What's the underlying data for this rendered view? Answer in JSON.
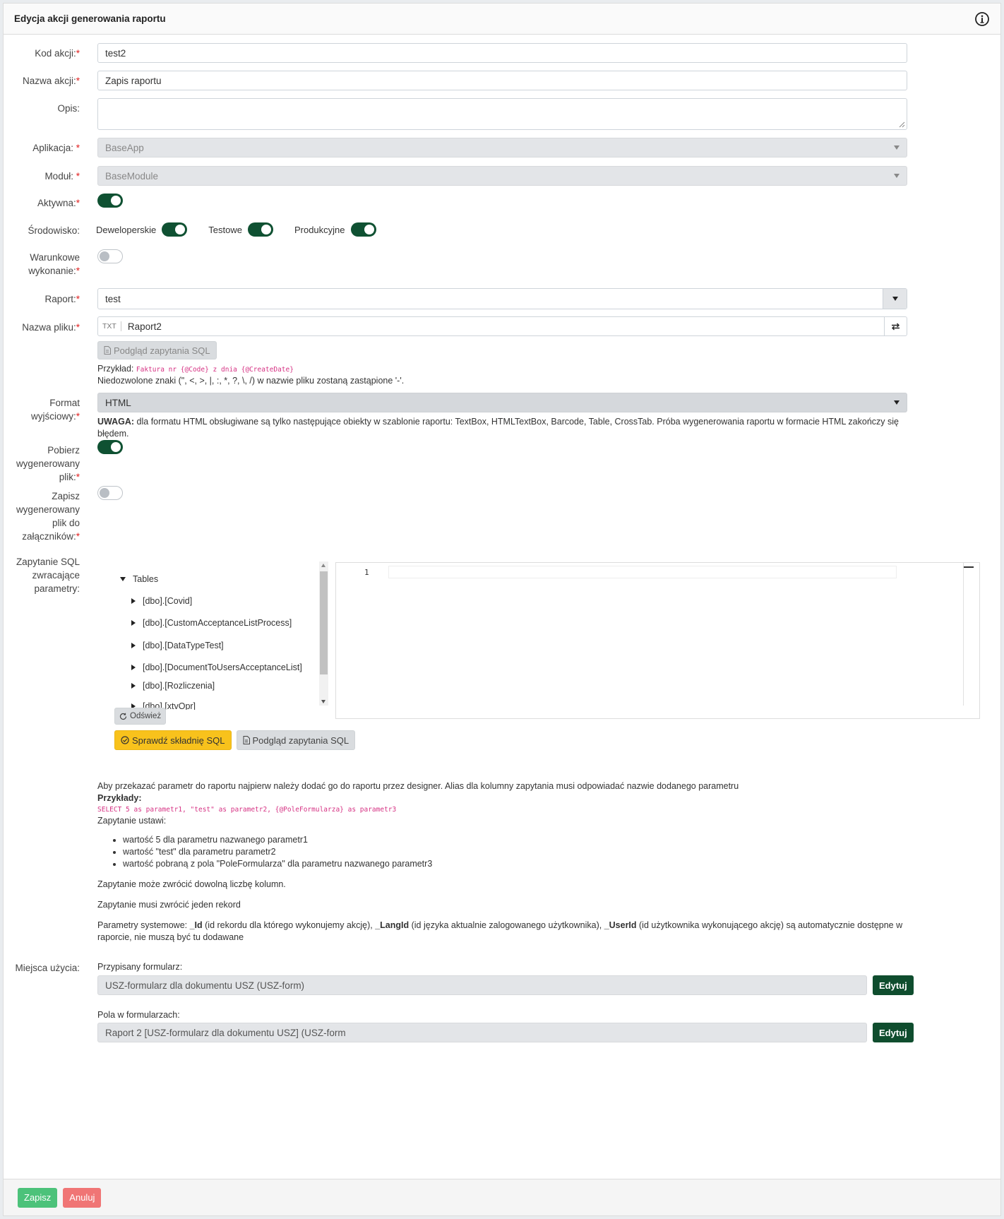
{
  "header": {
    "title": "Edycja akcji generowania raportu"
  },
  "fields": {
    "kod_akcji": {
      "label": "Kod akcji:",
      "value": "test2"
    },
    "nazwa_akcji": {
      "label": "Nazwa akcji:",
      "value": "Zapis raportu"
    },
    "opis": {
      "label": "Opis:",
      "value": ""
    },
    "aplikacja": {
      "label": "Aplikacja:",
      "value": "BaseApp"
    },
    "modul": {
      "label": "Moduł:",
      "value": "BaseModule"
    },
    "aktywna": {
      "label": "Aktywna:",
      "on": true
    },
    "srodowisko": {
      "label": "Środowisko:",
      "options": [
        {
          "label": "Deweloperskie",
          "on": true
        },
        {
          "label": "Testowe",
          "on": true
        },
        {
          "label": "Produkcyjne",
          "on": true
        }
      ]
    },
    "warunkowe": {
      "label_line1": "Warunkowe",
      "label_line2": "wykonanie:",
      "on": false
    },
    "raport": {
      "label": "Raport:",
      "value": "test"
    },
    "nazwa_pliku": {
      "label": "Nazwa pliku:",
      "prefix": "TXT",
      "value": "Raport2",
      "preview_button": "Podgląd zapytania SQL",
      "example_label": "Przykład:",
      "example_code": "Faktura nr {@Code} z dnia {@CreateDate}",
      "note": "Niedozwolone znaki (\", <, >, |, :, *, ?, \\, /) w nazwie pliku zostaną zastąpione '-'."
    },
    "format": {
      "label_line1": "Format",
      "label_line2": "wyjściowy:",
      "value": "HTML",
      "warning_bold": "UWAGA:",
      "warning_text": " dla formatu HTML obsługiwane są tylko następujące obiekty w szablonie raportu: TextBox, HTMLTextBox, Barcode, Table, CrossTab. Próba wygenerowania raportu w formacie HTML zakończy się błędem."
    },
    "pobierz": {
      "label_line1": "Pobierz",
      "label_line2": "wygenerowany",
      "label_line3": "plik:",
      "on": true
    },
    "zapisz": {
      "label_line1": "Zapisz",
      "label_line2": "wygenerowany",
      "label_line3": "plik do",
      "label_line4": "załączników:",
      "on": false
    },
    "sql": {
      "label_line1": "Zapytanie SQL",
      "label_line2": "zwracające",
      "label_line3": "parametry:",
      "tree_root": "Tables",
      "tree_items": [
        "[dbo].[Covid]",
        "[dbo].[CustomAcceptanceListProcess]",
        "[dbo].[DataTypeTest]",
        "[dbo].[DocumentToUsersAcceptanceList]",
        "[dbo].[Rozliczenia]",
        "[dbo].[xtvOpr]"
      ],
      "refresh_button": "Odśwież",
      "line_number": "1",
      "check_button": "Sprawdź składnię SQL",
      "preview_button": "Podgląd zapytania SQL"
    }
  },
  "help": {
    "intro": "Aby przekazać parametr do raportu najpierw należy dodać go do raportu przez designer. Alias dla kolumny zapytania musi odpowiadać nazwie dodanego parametru",
    "examples_label": "Przykłady:",
    "code": "SELECT 5 as parametr1, \"test\" as parametr2, {@PoleFormularza} as parametr3",
    "sets": "Zapytanie ustawi:",
    "bullets": [
      "wartość 5 dla parametru nazwanego parametr1",
      "wartość \"test\" dla parametru parametr2",
      "wartość pobraną z pola \"PoleFormularza\" dla parametru nazwanego parametr3"
    ],
    "p1": "Zapytanie może zwrócić dowolną liczbę kolumn.",
    "p2": "Zapytanie musi zwrócić jeden rekord",
    "sys_prefix": "Parametry systemowe: ",
    "sys_id": "_Id",
    "sys_id_desc": " (id rekordu dla którego wykonujemy akcję), ",
    "sys_lang": "_LangId",
    "sys_lang_desc": " (id języka aktualnie zalogowanego użytkownika), ",
    "sys_user": "_UserId",
    "sys_user_desc": " (id użytkownika wykonującego akcję) są automatycznie dostępne w raporcie, nie muszą być tu dodawane"
  },
  "usage": {
    "label": "Miejsca użycia:",
    "form_label": "Przypisany formularz:",
    "form_value": "USZ-formularz dla dokumentu USZ (USZ-form)",
    "fields_label": "Pola w formularzach:",
    "fields_value": "Raport 2 [USZ-formularz dla dokumentu USZ] (USZ-form",
    "edit_button": "Edytuj"
  },
  "footer": {
    "save": "Zapisz",
    "cancel": "Anuluj"
  }
}
